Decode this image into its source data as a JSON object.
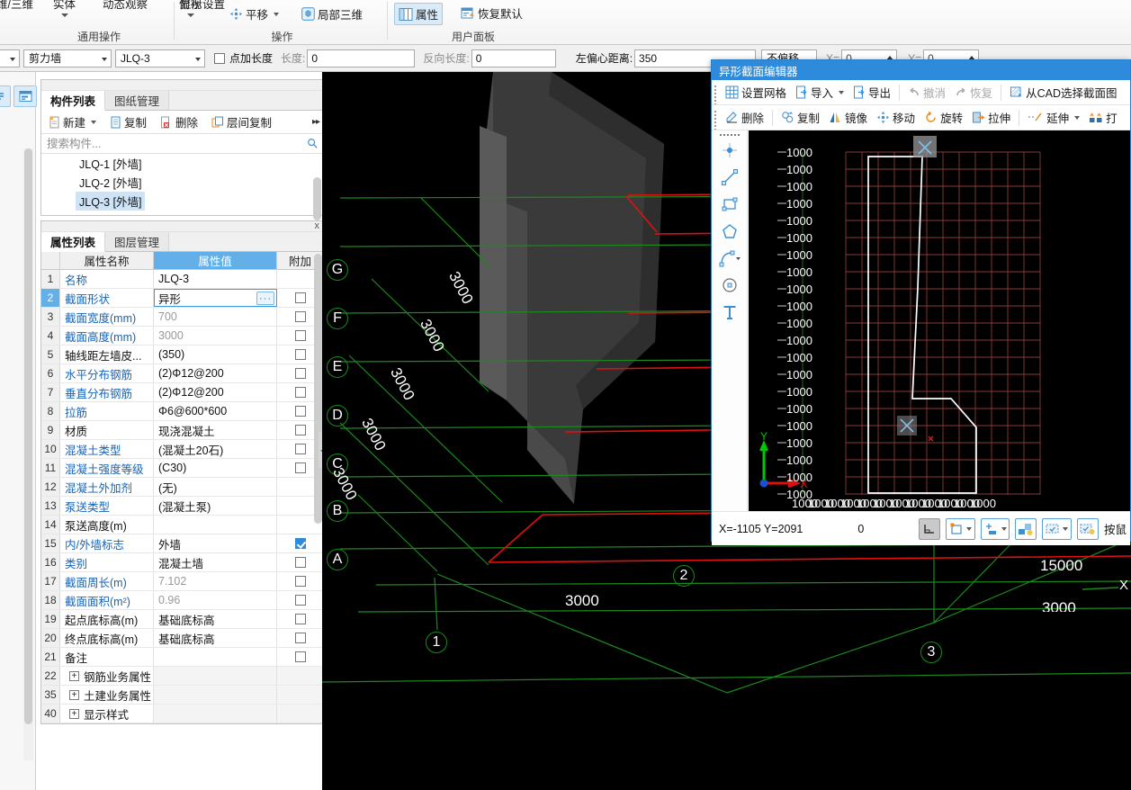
{
  "ribbon": {
    "groups": [
      {
        "label": "通用操作",
        "items": [
          {
            "text": "维/三维",
            "icon": "cube-icon",
            "has_caret": false
          },
          {
            "text": "实体",
            "icon": "solid-icon",
            "has_caret": true
          },
          {
            "text": "动态观察",
            "icon": "orbit-icon",
            "has_caret": false
          },
          {
            "text": "俯视",
            "icon": "topview-icon",
            "has_caret": true
          }
        ]
      },
      {
        "label": "操作",
        "items": [
          {
            "text": "显示设置",
            "icon": "display-settings-icon",
            "has_caret": false
          },
          {
            "text": "平移",
            "icon": "pan-icon",
            "has_caret": true
          },
          {
            "text": "局部三维",
            "icon": "local-3d-icon",
            "has_caret": false
          }
        ]
      },
      {
        "label": "用户面板",
        "items": [
          {
            "text": "属性",
            "icon": "properties-icon",
            "selected": true
          },
          {
            "text": "恢复默认",
            "icon": "restore-default-icon",
            "selected": false
          }
        ]
      }
    ]
  },
  "parambar": {
    "category": "剪力墙",
    "member": "JLQ-3",
    "point_add_length_label": "点加长度",
    "point_add_length_checked": false,
    "length_label": "长度:",
    "length_value": "0",
    "reverse_length_label": "反向长度:",
    "reverse_length_value": "0",
    "left_eccentric_label": "左偏心距离:",
    "left_eccentric_value": "350",
    "offset_mode": "不偏移",
    "x_label": "X=",
    "x_value": "0",
    "y_label": "Y=",
    "y_value": "0"
  },
  "component_panel": {
    "tabs": [
      {
        "label": "构件列表",
        "active": true
      },
      {
        "label": "图纸管理",
        "active": false
      }
    ],
    "commands": [
      {
        "label": "新建",
        "icon": "new-doc-icon",
        "has_caret": true
      },
      {
        "label": "复制",
        "icon": "copy-icon",
        "has_caret": false
      },
      {
        "label": "删除",
        "icon": "delete-icon",
        "has_caret": false
      },
      {
        "label": "层间复制",
        "icon": "layer-copy-icon",
        "has_caret": false
      }
    ],
    "overflow_glyph": "▸▸",
    "search_placeholder": "搜索构件...",
    "search_value": "",
    "items": [
      {
        "label": "JLQ-1 [外墙]",
        "selected": false
      },
      {
        "label": "JLQ-2 [外墙]",
        "selected": false
      },
      {
        "label": "JLQ-3 [外墙]",
        "selected": true
      }
    ]
  },
  "property_panel": {
    "close_glyph": "x",
    "tabs": [
      {
        "label": "属性列表",
        "active": true
      },
      {
        "label": "图层管理",
        "active": false
      }
    ],
    "headers": {
      "index": "",
      "name": "属性名称",
      "value": "属性值",
      "attach": "附加"
    },
    "rows": [
      {
        "idx": "1",
        "name": "名称",
        "value": "JLQ-3",
        "name_blue": true,
        "value_grey": false,
        "has_cb": false,
        "cb_on": false,
        "active": false,
        "ellipsis": false,
        "expander": false
      },
      {
        "idx": "2",
        "name": "截面形状",
        "value": "异形",
        "name_blue": true,
        "value_grey": false,
        "has_cb": true,
        "cb_on": false,
        "active": true,
        "ellipsis": true,
        "expander": false
      },
      {
        "idx": "3",
        "name": "截面宽度(mm)",
        "value": "700",
        "name_blue": true,
        "value_grey": true,
        "has_cb": true,
        "cb_on": false,
        "active": false,
        "ellipsis": false,
        "expander": false
      },
      {
        "idx": "4",
        "name": "截面高度(mm)",
        "value": "3000",
        "name_blue": true,
        "value_grey": true,
        "has_cb": true,
        "cb_on": false,
        "active": false,
        "ellipsis": false,
        "expander": false
      },
      {
        "idx": "5",
        "name": "轴线距左墙皮...",
        "value": "(350)",
        "name_blue": false,
        "value_grey": false,
        "has_cb": true,
        "cb_on": false,
        "active": false,
        "ellipsis": false,
        "expander": false
      },
      {
        "idx": "6",
        "name": "水平分布钢筋",
        "value": "(2)Φ12@200",
        "name_blue": true,
        "value_grey": false,
        "has_cb": true,
        "cb_on": false,
        "active": false,
        "ellipsis": false,
        "expander": false
      },
      {
        "idx": "7",
        "name": "垂直分布钢筋",
        "value": "(2)Φ12@200",
        "name_blue": true,
        "value_grey": false,
        "has_cb": true,
        "cb_on": false,
        "active": false,
        "ellipsis": false,
        "expander": false
      },
      {
        "idx": "8",
        "name": "拉筋",
        "value": "Φ6@600*600",
        "name_blue": true,
        "value_grey": false,
        "has_cb": true,
        "cb_on": false,
        "active": false,
        "ellipsis": false,
        "expander": false
      },
      {
        "idx": "9",
        "name": "材质",
        "value": "现浇混凝土",
        "name_blue": false,
        "value_grey": false,
        "has_cb": true,
        "cb_on": false,
        "active": false,
        "ellipsis": false,
        "expander": false
      },
      {
        "idx": "10",
        "name": "混凝土类型",
        "value": "(混凝土20石)",
        "name_blue": true,
        "value_grey": false,
        "has_cb": true,
        "cb_on": false,
        "active": false,
        "ellipsis": false,
        "expander": false
      },
      {
        "idx": "11",
        "name": "混凝土强度等级",
        "value": "(C30)",
        "name_blue": true,
        "value_grey": false,
        "has_cb": true,
        "cb_on": false,
        "active": false,
        "ellipsis": false,
        "expander": false
      },
      {
        "idx": "12",
        "name": "混凝土外加剂",
        "value": "(无)",
        "name_blue": true,
        "value_grey": false,
        "has_cb": false,
        "cb_on": false,
        "active": false,
        "ellipsis": false,
        "expander": false
      },
      {
        "idx": "13",
        "name": "泵送类型",
        "value": "(混凝土泵)",
        "name_blue": true,
        "value_grey": false,
        "has_cb": false,
        "cb_on": false,
        "active": false,
        "ellipsis": false,
        "expander": false
      },
      {
        "idx": "14",
        "name": "泵送高度(m)",
        "value": "",
        "name_blue": false,
        "value_grey": false,
        "has_cb": false,
        "cb_on": false,
        "active": false,
        "ellipsis": false,
        "expander": false
      },
      {
        "idx": "15",
        "name": "内/外墙标志",
        "value": "外墙",
        "name_blue": true,
        "value_grey": false,
        "has_cb": true,
        "cb_on": true,
        "active": false,
        "ellipsis": false,
        "expander": false
      },
      {
        "idx": "16",
        "name": "类别",
        "value": "混凝土墙",
        "name_blue": true,
        "value_grey": false,
        "has_cb": true,
        "cb_on": false,
        "active": false,
        "ellipsis": false,
        "expander": false
      },
      {
        "idx": "17",
        "name": "截面周长(m)",
        "value": "7.102",
        "name_blue": true,
        "value_grey": true,
        "has_cb": true,
        "cb_on": false,
        "active": false,
        "ellipsis": false,
        "expander": false
      },
      {
        "idx": "18",
        "name": "截面面积(m²)",
        "value": "0.96",
        "name_blue": true,
        "value_grey": true,
        "has_cb": true,
        "cb_on": false,
        "active": false,
        "ellipsis": false,
        "expander": false
      },
      {
        "idx": "19",
        "name": "起点底标高(m)",
        "value": "基础底标高",
        "name_blue": false,
        "value_grey": false,
        "has_cb": true,
        "cb_on": false,
        "active": false,
        "ellipsis": false,
        "expander": false
      },
      {
        "idx": "20",
        "name": "终点底标高(m)",
        "value": "基础底标高",
        "name_blue": false,
        "value_grey": false,
        "has_cb": true,
        "cb_on": false,
        "active": false,
        "ellipsis": false,
        "expander": false
      },
      {
        "idx": "21",
        "name": "备注",
        "value": "",
        "name_blue": false,
        "value_grey": false,
        "has_cb": true,
        "cb_on": false,
        "active": false,
        "ellipsis": false,
        "expander": false
      },
      {
        "idx": "22",
        "name": "钢筋业务属性",
        "value": "",
        "name_blue": false,
        "value_grey": false,
        "has_cb": false,
        "cb_on": false,
        "active": false,
        "ellipsis": false,
        "expander": true
      },
      {
        "idx": "35",
        "name": "土建业务属性",
        "value": "",
        "name_blue": false,
        "value_grey": false,
        "has_cb": false,
        "cb_on": false,
        "active": false,
        "ellipsis": false,
        "expander": true
      },
      {
        "idx": "40",
        "name": "显示样式",
        "value": "",
        "name_blue": false,
        "value_grey": false,
        "has_cb": false,
        "cb_on": false,
        "active": false,
        "ellipsis": false,
        "expander": true
      }
    ]
  },
  "viewport": {
    "grid_tags_letters": [
      "G",
      "F",
      "E",
      "D",
      "C",
      "B",
      "A"
    ],
    "grid_tags_numbers": [
      "1",
      "2",
      "3"
    ],
    "dimension_labels": [
      "3000",
      "3000",
      "3000",
      "3000",
      "3000",
      "3000",
      "15000"
    ],
    "axis_x_label": "X",
    "colors": {
      "background": "#000000",
      "grid_line": "#1c8a1c",
      "member_line": "#e01010",
      "solid": "#3a3a3a"
    }
  },
  "dialog": {
    "title": "异形截面编辑器",
    "toolbar_row1": [
      {
        "label": "设置网格",
        "icon": "grid-settings-icon",
        "disabled": false,
        "has_caret": false
      },
      {
        "label": "导入",
        "icon": "import-icon",
        "disabled": false,
        "has_caret": true
      },
      {
        "label": "导出",
        "icon": "export-icon",
        "disabled": false,
        "has_caret": false
      },
      {
        "label": "撤消",
        "icon": "undo-icon",
        "disabled": true,
        "has_caret": false
      },
      {
        "label": "恢复",
        "icon": "redo-icon",
        "disabled": true,
        "has_caret": false
      },
      {
        "label": "从CAD选择截面图",
        "icon": "cad-select-icon",
        "disabled": false,
        "has_caret": false
      }
    ],
    "toolbar_row2": [
      {
        "label": "删除",
        "icon": "erase-icon",
        "has_caret": false
      },
      {
        "label": "复制",
        "icon": "copy-icon",
        "has_caret": false
      },
      {
        "label": "镜像",
        "icon": "mirror-icon",
        "has_caret": false
      },
      {
        "label": "移动",
        "icon": "move-icon",
        "has_caret": false
      },
      {
        "label": "旋转",
        "icon": "rotate-icon",
        "has_caret": false
      },
      {
        "label": "拉伸",
        "icon": "stretch-icon",
        "has_caret": false
      },
      {
        "label": "延伸",
        "icon": "extend-icon",
        "has_caret": true
      },
      {
        "label": "打",
        "icon": "break-icon",
        "has_caret": false
      }
    ],
    "draw_tools": [
      {
        "name": "point-tool-icon",
        "has_caret": false
      },
      {
        "name": "line-tool-icon",
        "has_caret": false
      },
      {
        "name": "rectangle-tool-icon",
        "has_caret": false
      },
      {
        "name": "polygon-tool-icon",
        "has_caret": false
      },
      {
        "name": "arc-tool-icon",
        "has_caret": true
      },
      {
        "name": "circle-tool-icon",
        "has_caret": false
      },
      {
        "name": "text-tool-icon",
        "has_caret": false
      }
    ],
    "status": {
      "coords": "X=-1105 Y=2091",
      "value": "0",
      "hint": "按鼠",
      "buttons": [
        {
          "name": "ortho-toggle",
          "pressed": true,
          "has_caret": false
        },
        {
          "name": "object-snap-toggle",
          "pressed": false,
          "has_caret": true
        },
        {
          "name": "point-snap-toggle",
          "pressed": false,
          "has_caret": true
        },
        {
          "name": "dynamic-input-toggle",
          "pressed": false,
          "has_caret": false
        },
        {
          "name": "selection-mode-toggle",
          "pressed": false,
          "has_caret": true
        },
        {
          "name": "highlight-toggle",
          "pressed": false,
          "has_caret": false
        }
      ]
    },
    "canvas": {
      "x_axis_letter": "X",
      "y_axis_letter": "Y",
      "x_tick_labels": [
        "1000",
        "1000",
        "1000",
        "1000",
        "1000",
        "1000",
        "1000",
        "1000",
        "1000",
        "1000",
        "1000",
        "1000"
      ],
      "y_tick_labels": [
        "1000",
        "1000",
        "1000",
        "1000",
        "1000",
        "1000",
        "1000",
        "1000",
        "1000",
        "1000",
        "1000",
        "1000",
        "1000",
        "1000",
        "1000",
        "1000",
        "1000",
        "1000",
        "1000",
        "1000",
        "1000"
      ],
      "grid_color": "#8c3a3a",
      "shape_color": "#ffffff",
      "background": "#000000"
    }
  }
}
